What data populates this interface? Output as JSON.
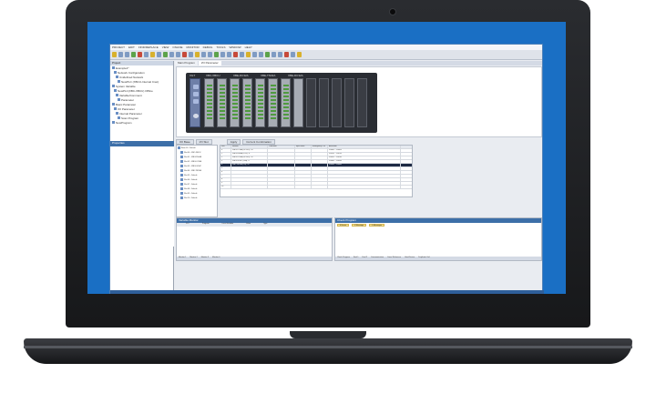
{
  "window": {
    "menu": [
      "PROJECT",
      "EDIT",
      "FIND/REPLACE",
      "VIEW",
      "ONLINE",
      "MONITOR",
      "DEBUG",
      "TOOLS",
      "WINDOW",
      "HELP"
    ],
    "doc_tabs": [
      "Main Program",
      "I/O Parameter"
    ],
    "left_title": "Project",
    "tree": [
      "Example1*",
      "Network Configuration",
      "Unidefined Network",
      "NewPLC (XBCU-Internal Cnet)",
      "System Variable",
      "NewPLC(XBC-XBCU) Offline",
      "Variable/Comment",
      "Parameter",
      "Basic Parameter",
      "I/O Parameter",
      "Internal Parameter",
      "Scan Program",
      "NewProgram"
    ],
    "sub_title": "Properties",
    "rack_labels": [
      "XBC-XBCU",
      "XBE-DC32A",
      "XBE-TN32A",
      "XBE-DC32A"
    ],
    "cpu_label": "XGT",
    "grid_tabs": [
      "I/O Base",
      "I/O Slot",
      "Apply",
      "Current Combination"
    ],
    "grid_headers": [
      "Slot",
      "Module",
      "Comment",
      "Input Filter",
      "Emergency Out",
      "Allocation"
    ],
    "grid_rows": [
      [
        "0",
        "XBF-DC16A (DC24V), 16",
        "",
        "",
        "",
        "P0000 ~ P000F"
      ],
      [
        "1",
        "XBF-RD04A (RTD), 4",
        "",
        "",
        "",
        "P0010 ~ P001F"
      ],
      [
        "2",
        "XBF-DC32A (DC24V), 32",
        "",
        "",
        "",
        "P0020 ~ P003F"
      ],
      [
        "3",
        "XBF-DV04C (D/A), 4",
        "",
        "",
        "",
        "P0040 ~ P004F"
      ],
      [
        "4",
        "XBF-TN32A (TR), 32",
        "",
        "",
        "",
        "P0050 ~ P006F"
      ],
      [
        "5",
        "",
        "",
        "",
        "",
        ""
      ],
      [
        "6",
        "",
        "",
        "",
        "",
        ""
      ],
      [
        "7",
        "",
        "",
        "",
        "",
        ""
      ],
      [
        "8",
        "",
        "",
        "",
        "",
        ""
      ],
      [
        "9",
        "",
        "",
        "",
        "",
        ""
      ],
      [
        "10",
        "",
        "",
        "",
        "",
        ""
      ]
    ],
    "selected_row": 4,
    "slot_tree": [
      "Base 00 - Default",
      "Slot 00 - XBC-XBCU",
      "Slot 01 - XBF-RD04A",
      "Slot 02 - XBF-DC32A",
      "Slot 03 - XBF-DV04C",
      "Slot 04 - XBF-TN32A",
      "Slot 05 - Default",
      "Slot 06 - Default",
      "Slot 07 - Default",
      "Slot 08 - Default",
      "Slot 09 - Default",
      "Slot 10 - Default"
    ],
    "monitor_title": "Variable Monitor",
    "monitor_headers": [
      "PLC",
      "Program",
      "Local Variable",
      "Value",
      "Type"
    ],
    "monitor_tabs": [
      "Monitor 1",
      "Monitor 2",
      "Monitor 3",
      "Monitor 4"
    ],
    "check_title": "Check Program",
    "check_chips": [
      "0 Errors",
      "0 Warnings",
      "0 Messages"
    ],
    "check_tabs": [
      "Check Program",
      "Find 1",
      "Find 2",
      "Communication",
      "Cross Reference",
      "Used Device",
      "Duplicate Coil"
    ]
  },
  "colors": {
    "screen": "#1a6fc4",
    "title_accent": "#3d6fa8"
  }
}
